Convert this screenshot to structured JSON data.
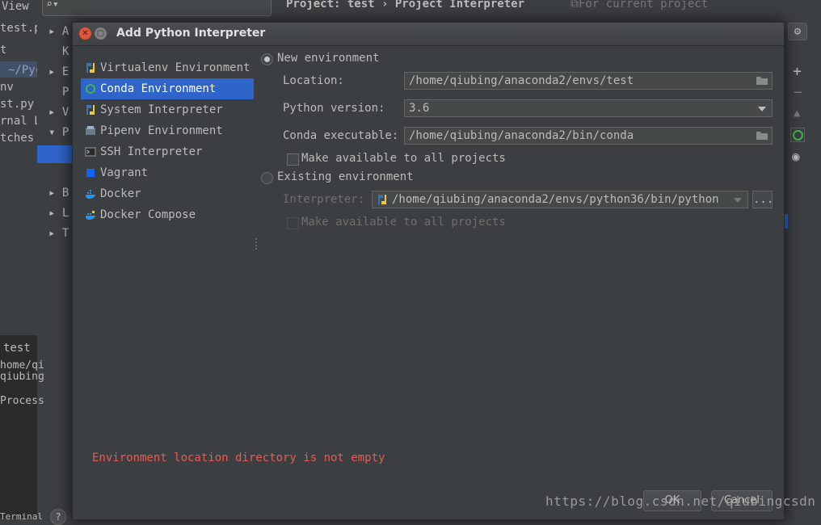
{
  "background": {
    "menu_view": "View",
    "left_items": [
      "test.p",
      "t",
      "~/Pyc",
      "nv",
      "st.py",
      "rnal L",
      "tches"
    ],
    "tree_labels": [
      "A",
      "K",
      "E",
      "P",
      "V",
      "P",
      "B",
      "L",
      "T"
    ],
    "breadcrumb": "Project: test › Project Interpreter",
    "for_current_project": "For current project",
    "run_lines": [
      "test",
      "home/qi",
      "qiubing",
      "Process"
    ],
    "bottom_tab": "Terminal"
  },
  "dialog": {
    "title": "Add Python Interpreter",
    "env_types": [
      {
        "label": "Virtualenv Environment",
        "icon": "python-icon"
      },
      {
        "label": "Conda Environment",
        "icon": "conda-icon",
        "selected": true
      },
      {
        "label": "System Interpreter",
        "icon": "python-icon"
      },
      {
        "label": "Pipenv Environment",
        "icon": "pipenv-icon"
      },
      {
        "label": "SSH Interpreter",
        "icon": "terminal-icon"
      },
      {
        "label": "Vagrant",
        "icon": "vagrant-icon"
      },
      {
        "label": "Docker",
        "icon": "docker-icon"
      },
      {
        "label": "Docker Compose",
        "icon": "docker-compose-icon"
      }
    ],
    "new_env": {
      "radio_label": "New environment",
      "location_label": "Location:",
      "location_value": "/home/qiubing/anaconda2/envs/test",
      "python_version_label": "Python version:",
      "python_version_value": "3.6",
      "conda_exec_label": "Conda executable:",
      "conda_exec_value": "/home/qiubing/anaconda2/bin/conda",
      "make_available_label": "Make available to all projects"
    },
    "existing_env": {
      "radio_label": "Existing environment",
      "interpreter_label": "Interpreter:",
      "interpreter_value": "/home/qiubing/anaconda2/envs/python36/bin/python",
      "browse_label": "...",
      "make_available_label": "Make available to all projects"
    },
    "error": "Environment location directory is not empty",
    "ok_label": "OK",
    "cancel_label": "Cancel"
  },
  "watermark": "https://blog.csdn.net/qiubingcsdn",
  "colors": {
    "selection": "#2f65ca",
    "error": "#e85a54",
    "background": "#3c3f41"
  }
}
